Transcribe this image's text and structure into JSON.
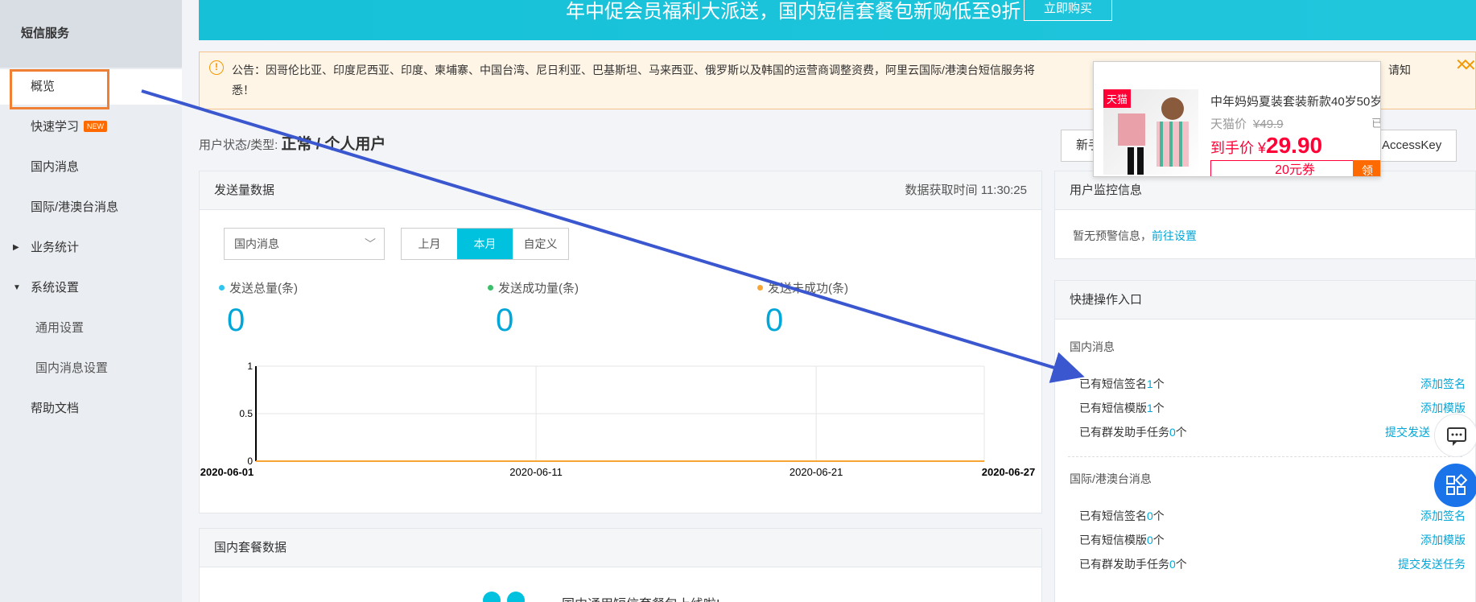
{
  "sidebar": {
    "title": "短信服务",
    "items": [
      {
        "label": "概览"
      },
      {
        "label": "快速学习",
        "badge": "NEW"
      },
      {
        "label": "国内消息"
      },
      {
        "label": "国际/港澳台消息"
      },
      {
        "label": "业务统计"
      },
      {
        "label": "系统设置"
      },
      {
        "label": "通用设置"
      },
      {
        "label": "国内消息设置"
      },
      {
        "label": "帮助文档"
      }
    ]
  },
  "banner": {
    "text": "年中促会员福利大派送，国内短信套餐包新购低至9折",
    "button": "立即购买"
  },
  "notice": {
    "text": "公告：因哥伦比亚、印度尼西亚、印度、柬埔寨、中国台湾、尼日利亚、巴基斯坦、马来西亚、俄罗斯以及韩国的运营商调整资费，阿里云国际/港澳台短信服务将",
    "text_tail": "悉！",
    "text_right": "，请知"
  },
  "user_status": {
    "label": "用户状态/类型:",
    "value": "正常 / 个人用户"
  },
  "right_buttons": {
    "new": "新手",
    "accesskey": "AccessKey"
  },
  "send_panel": {
    "title": "发送量数据",
    "fetch_time": "数据获取时间 11:30:25",
    "select_value": "国内消息",
    "periods": [
      "上月",
      "本月",
      "自定义"
    ],
    "stats": [
      {
        "label": "发送总量(条)",
        "value": "0",
        "color": "#2fc5f0"
      },
      {
        "label": "发送成功量(条)",
        "value": "0",
        "color": "#3bbf6a"
      },
      {
        "label": "发送未成功(条)",
        "value": "0",
        "color": "#f7a636"
      }
    ]
  },
  "chart_data": {
    "type": "line",
    "x": [
      "2020-06-01",
      "2020-06-11",
      "2020-06-21",
      "2020-06-27"
    ],
    "y_ticks": [
      "1",
      "0.5",
      "0"
    ],
    "ylim": [
      0,
      1
    ],
    "series": [
      {
        "values": [
          0,
          0,
          0,
          0
        ],
        "color": "#f7a636"
      }
    ],
    "grid": true
  },
  "package_panel": {
    "title": "国内套餐数据",
    "teaser": "国内通用短信套餐包上线啦!"
  },
  "monitor_panel": {
    "title": "用户监控信息",
    "text": "暂无预警信息，",
    "link": "前往设置"
  },
  "quick_panel": {
    "title": "快捷操作入口",
    "sections": [
      {
        "title": "国内消息",
        "rows": [
          {
            "pre": "已有短信签名",
            "n": "1",
            "post": "个",
            "action": "添加签名"
          },
          {
            "pre": "已有短信模版",
            "n": "1",
            "post": "个",
            "action": "添加模版"
          },
          {
            "pre": "已有群发助手任务",
            "n": "0",
            "post": "个",
            "action": "提交发送"
          }
        ]
      },
      {
        "title": "国际/港澳台消息",
        "rows": [
          {
            "pre": "已有短信签名",
            "n": "0",
            "post": "个",
            "action": "添加签名"
          },
          {
            "pre": "已有短信模版",
            "n": "0",
            "post": "个",
            "action": "添加模版"
          },
          {
            "pre": "已有群发助手任务",
            "n": "0",
            "post": "个",
            "action": "提交发送任务"
          }
        ]
      }
    ]
  },
  "popup": {
    "badge": "天猫",
    "title": "中年妈妈夏装套装新款40岁50岁",
    "tmall_price_label": "天猫价",
    "tmall_price": "¥49.9",
    "price_label": "到手价 ¥",
    "price": "29.90",
    "coupon": "20元券",
    "coupon_btn": "领",
    "side_mark": "已"
  },
  "colors": {
    "accent": "#00c1de",
    "link": "#00a7d8",
    "arrow": "#3a57cf",
    "highlight": "#f08033"
  }
}
